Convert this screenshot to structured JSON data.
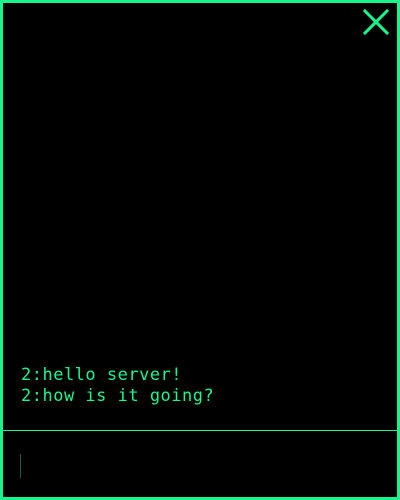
{
  "chat": {
    "messages": [
      {
        "text": "2:hello server!"
      },
      {
        "text": "2:how is it going?"
      }
    ],
    "input": {
      "value": "",
      "placeholder": ""
    }
  },
  "icons": {
    "close": "close-icon"
  },
  "colors": {
    "accent": "#19f58c",
    "background": "#000000",
    "caret": "#1a5c3c"
  }
}
